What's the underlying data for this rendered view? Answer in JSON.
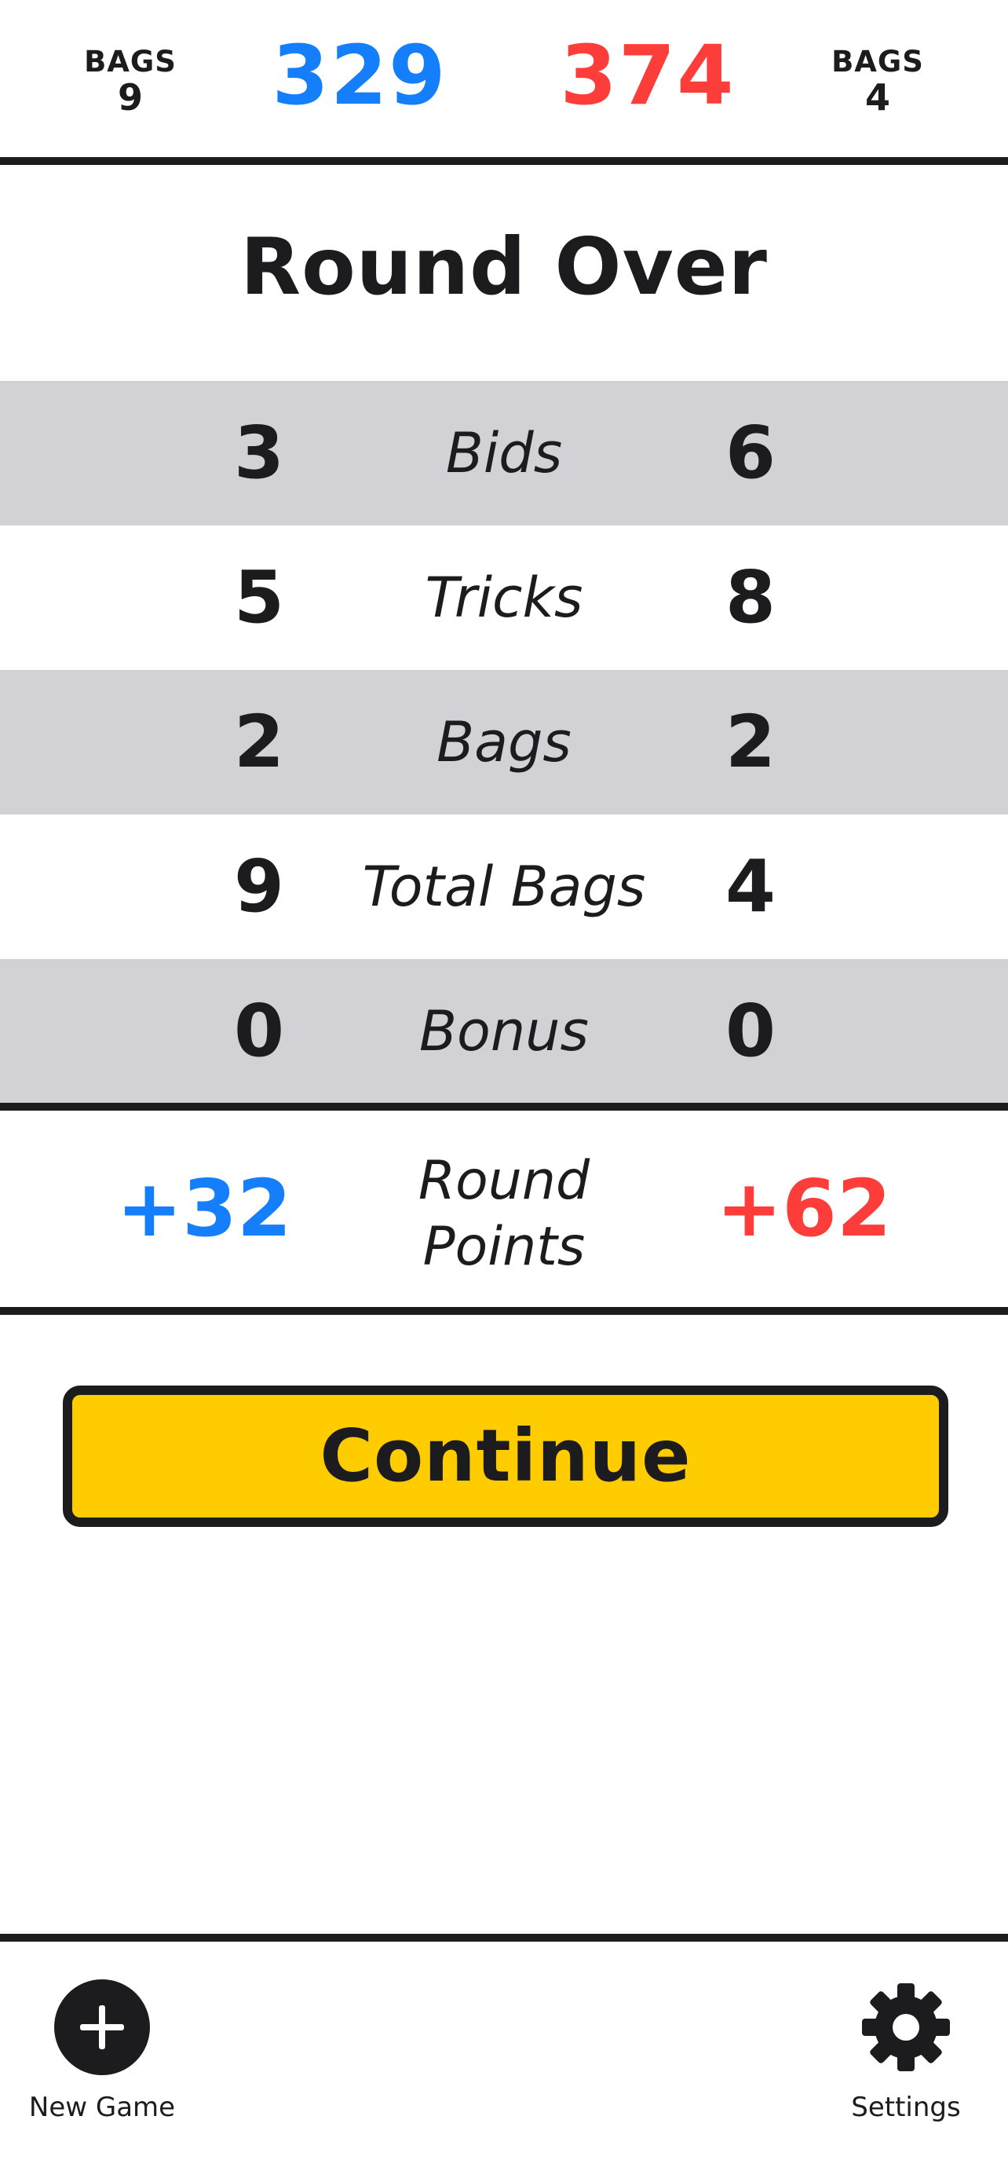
{
  "header": {
    "team_left": {
      "bags_label": "BAGS",
      "bags": "9",
      "score": "329",
      "color": "#147efb"
    },
    "team_right": {
      "bags_label": "BAGS",
      "bags": "4",
      "score": "374",
      "color": "#fc3d39"
    }
  },
  "title": "Round Over",
  "stats": [
    {
      "label": "Bids",
      "left": "3",
      "right": "6"
    },
    {
      "label": "Tricks",
      "left": "5",
      "right": "8"
    },
    {
      "label": "Bags",
      "left": "2",
      "right": "2"
    },
    {
      "label": "Total Bags",
      "left": "9",
      "right": "4"
    },
    {
      "label": "Bonus",
      "left": "0",
      "right": "0"
    }
  ],
  "round_points": {
    "label_line1": "Round",
    "label_line2": "Points",
    "left": "+32",
    "right": "+62"
  },
  "continue_button": {
    "label": "Continue",
    "color": "#ffcc00"
  },
  "tabbar": {
    "new_game": {
      "label": "New Game",
      "icon": "plus-circle-icon"
    },
    "settings": {
      "label": "Settings",
      "icon": "gear-icon"
    }
  },
  "colors": {
    "text": "#1c1c1e",
    "row_shade": "#d1d1d6",
    "blue": "#147efb",
    "red": "#fc3d39"
  }
}
